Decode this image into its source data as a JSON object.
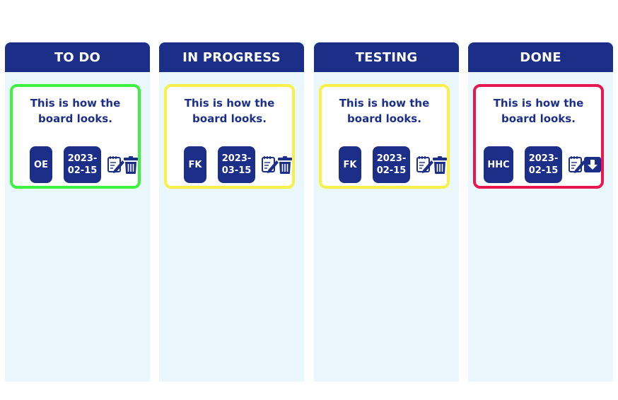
{
  "colors": {
    "header_bg": "#1c2f88",
    "column_bg": "#eaf7fd",
    "text": "#1c2f88",
    "todo_border": "#3df23f",
    "in_progress_border": "#f9f04a",
    "testing_border": "#f9f04a",
    "done_border": "#e8174f"
  },
  "columns": [
    {
      "title": "TO DO",
      "card": {
        "text": "This is how the board looks.",
        "initials": "OE",
        "date": "2023-02-15",
        "icons": [
          "edit-icon",
          "trash-icon"
        ]
      }
    },
    {
      "title": "IN PROGRESS",
      "card": {
        "text": "This is how the board looks.",
        "initials": "FK",
        "date": "2023-03-15",
        "icons": [
          "edit-icon",
          "trash-icon"
        ]
      }
    },
    {
      "title": "TESTING",
      "card": {
        "text": "This is how the board looks.",
        "initials": "FK",
        "date": "2023-02-15",
        "icons": [
          "edit-icon",
          "trash-icon"
        ]
      }
    },
    {
      "title": "DONE",
      "card": {
        "text": "This is how the board looks.",
        "initials": "HHC",
        "date": "2023-02-15",
        "icons": [
          "edit-icon",
          "archive-download-icon"
        ]
      }
    }
  ]
}
